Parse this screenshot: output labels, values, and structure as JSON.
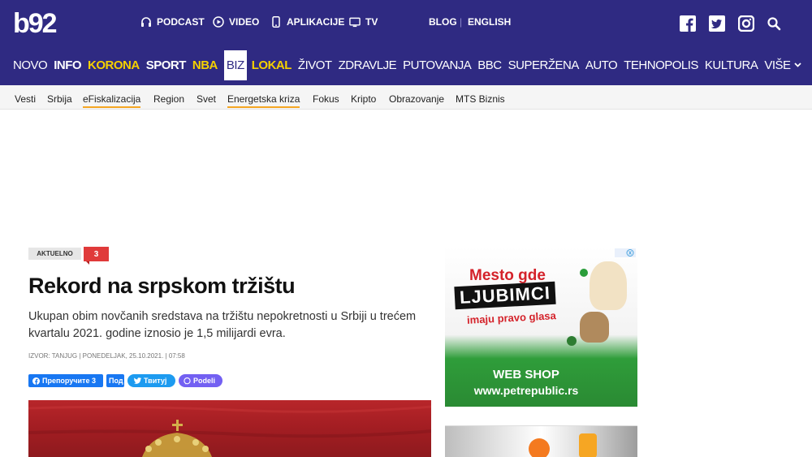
{
  "header": {
    "logo": "b92",
    "utility": [
      {
        "label": "PODCAST",
        "icon": "headphones-icon"
      },
      {
        "label": "VIDEO",
        "icon": "play-icon"
      },
      {
        "label": "APLIKACIJE",
        "icon": "phone-icon"
      },
      {
        "label": "TV",
        "icon": "tv-icon"
      }
    ],
    "blog": "BLOG",
    "separator": "|",
    "english": "ENGLISH",
    "social": [
      "facebook-icon",
      "twitter-icon",
      "instagram-icon",
      "search-icon"
    ]
  },
  "nav": {
    "items": [
      "NOVO",
      "INFO",
      "KORONA",
      "SPORT",
      "NBA",
      "BIZ",
      "LOKAL",
      "ŽIVOT",
      "ZDRAVLJE",
      "PUTOVANJA",
      "BBC",
      "SUPERŽENA",
      "AUTO",
      "TEHNOPOLIS",
      "KULTURA",
      "VIŠE"
    ]
  },
  "subnav": {
    "items": [
      "Vesti",
      "Srbija",
      "eFiskalizacija",
      "Region",
      "Svet",
      "Energetska kriza",
      "Fokus",
      "Kripto",
      "Obrazovanje",
      "MTS Biznis"
    ]
  },
  "article": {
    "tag": "AKTUELNO",
    "comments": "3",
    "title": "Rekord na srpskom tržištu",
    "lead": "Ukupan obim novčanih sredstava na tržištu nepokretnosti u Srbiji u trećem kvartalu 2021. godine iznosio je 1,5 milijardi evra.",
    "meta": "IZVOR: TANJUG | PONEDELJAK, 25.10.2021. | 07:58"
  },
  "share": {
    "facebook": "Препоручите 3",
    "facebook2": "Под",
    "twitter": "Твитуј",
    "viber": "Podeli"
  },
  "ad": {
    "line1": "Mesto gde",
    "line2": "LJUBIMCI",
    "line3": "imaju pravo glasa",
    "line4": "WEB SHOP",
    "line5": "www.petrepublic.rs"
  },
  "colors": {
    "brand": "#2f2a82",
    "accent": "#f5d000",
    "badge": "#e03a3a"
  }
}
